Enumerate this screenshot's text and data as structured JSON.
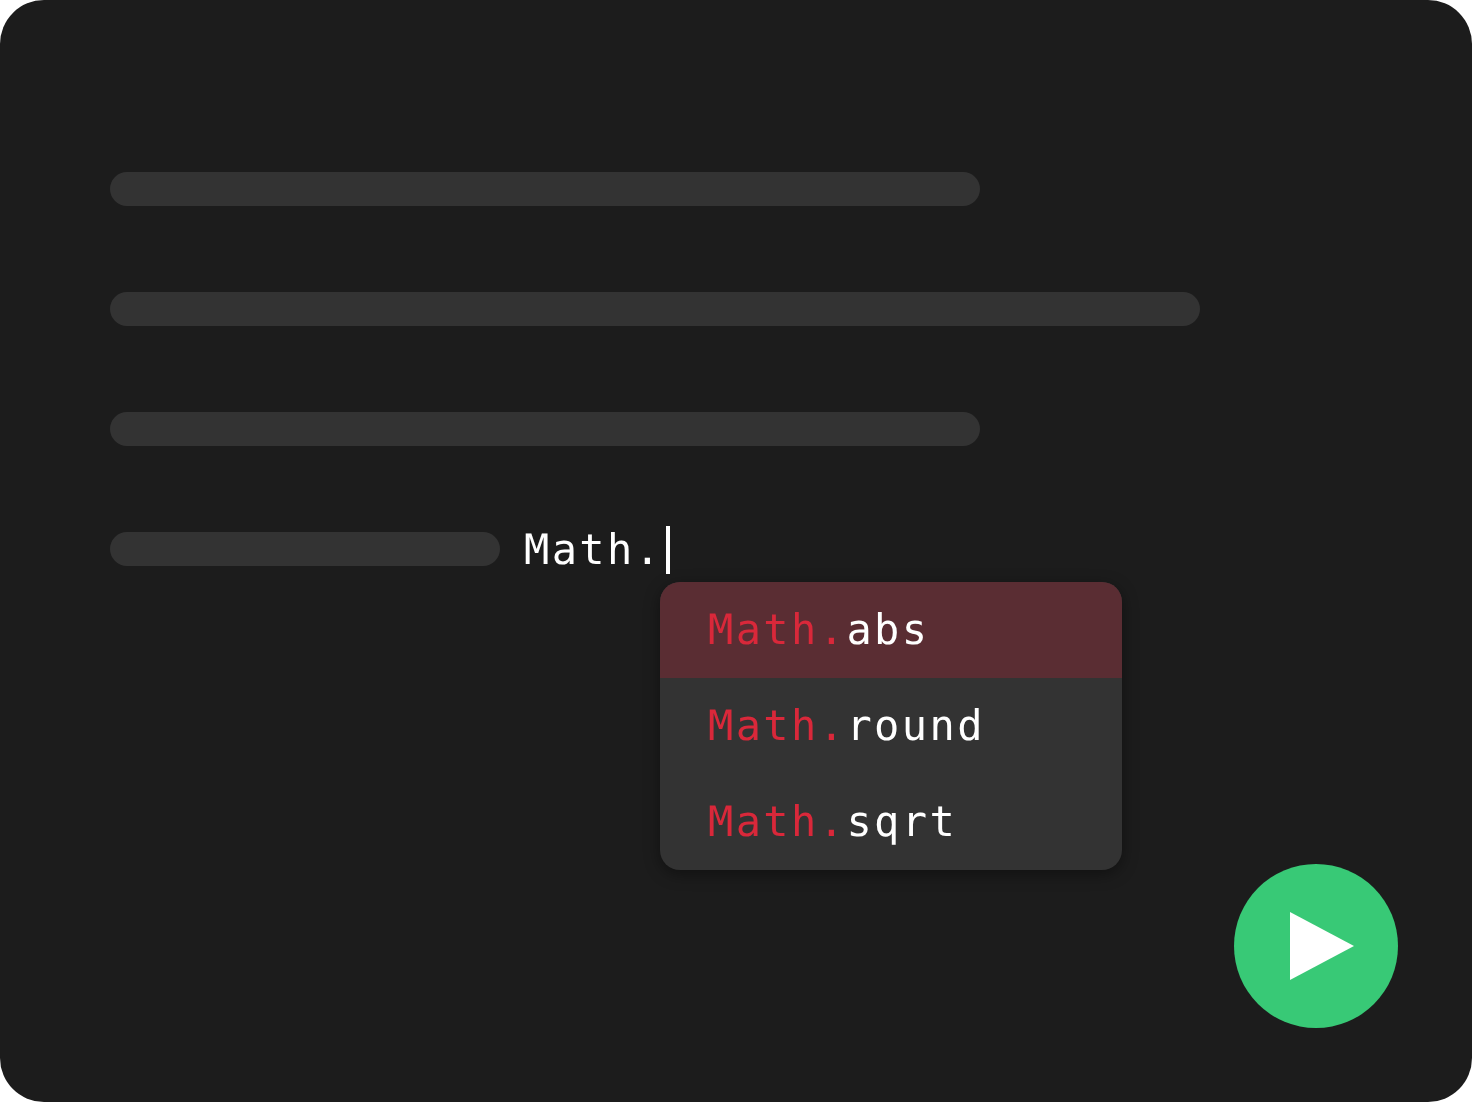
{
  "editor": {
    "typed_text": "Math.",
    "suggestions": [
      {
        "prefix": "Math.",
        "name": "abs",
        "selected": true
      },
      {
        "prefix": "Math.",
        "name": "round",
        "selected": false
      },
      {
        "prefix": "Math.",
        "name": "sqrt",
        "selected": false
      }
    ]
  }
}
